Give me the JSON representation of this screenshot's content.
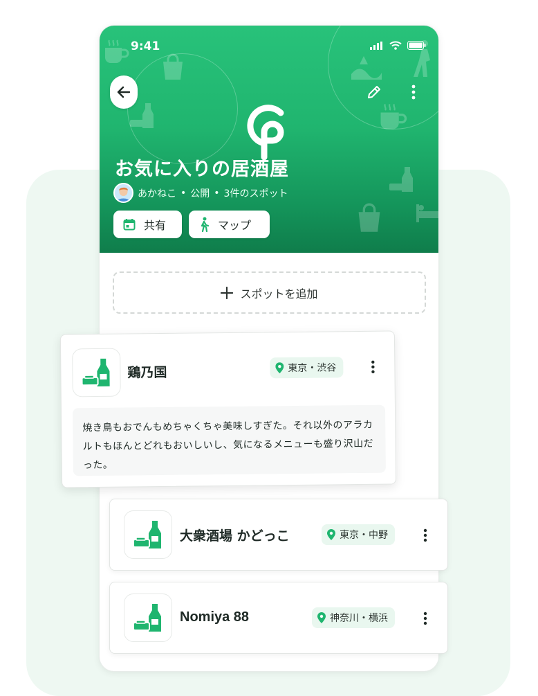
{
  "status_bar": {
    "time": "9:41"
  },
  "header": {
    "title": "お気に入りの居酒屋",
    "meta": {
      "user": "あかねこ",
      "visibility": "公開",
      "spot_count": "3件のスポット",
      "separator": "•"
    },
    "buttons": {
      "share": "共有",
      "map": "マップ"
    },
    "icons": {
      "back": "arrow-left-icon",
      "edit": "pencil-icon",
      "more": "more-vertical-icon"
    }
  },
  "add_spot": {
    "label": "スポットを追加",
    "icon": "plus-icon"
  },
  "spots": [
    {
      "name": "鶏乃国",
      "location": "東京・渋谷",
      "comment": "焼き鳥もおでんもめちゃくちゃ美味しすぎた。それ以外のアラカルトもほんとどれもおいしいし、気になるメニューも盛り沢山だった。"
    },
    {
      "name": "大衆酒場 かどっこ",
      "location": "東京・中野"
    },
    {
      "name": "Nomiya 88",
      "location": "神奈川・横浜"
    }
  ],
  "colors": {
    "accent": "#1fb56f",
    "accent_dark": "#0f7d4b",
    "badge_bg": "#e9f7ef",
    "panel_bg": "#eef8f2"
  }
}
